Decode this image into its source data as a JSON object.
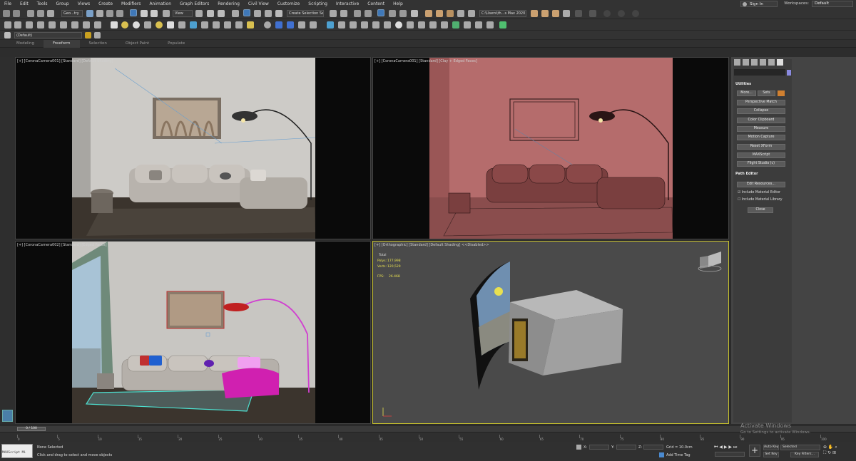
{
  "menu": [
    "File",
    "Edit",
    "Tools",
    "Group",
    "Views",
    "Create",
    "Modifiers",
    "Animation",
    "Graph Editors",
    "Rendering",
    "Civil View",
    "Customize",
    "Scripting",
    "Interactive",
    "Content",
    "Help"
  ],
  "account": {
    "sign_in": "Sign In",
    "workspaces_label": "Workspaces:",
    "workspace": "Default"
  },
  "toolbar": {
    "selection_filter": "Geo...try",
    "view_combo": "View",
    "selection_set": "Create Selection Se",
    "project_path": "C:\\Users\\th...s Max 2020",
    "layer_combo": "(Default)"
  },
  "ribbon": {
    "tabs": [
      "Modeling",
      "Freeform",
      "Selection",
      "Object Paint",
      "Populate"
    ],
    "active": "Freeform"
  },
  "viewports": {
    "top_left": "[+] [CoronaCamera001] [Standard] [Default Shading]",
    "top_right": "[+] [CoronaCamera001] [Standard] [Clay + Edged Faces]",
    "bottom_left": "[+] [CoronaCamera002] [Standard] [Edged Faces]",
    "bottom_right": "[+] [Orthographic] [Standard] [Default Shading]  <<Disabled>>"
  },
  "stats": {
    "total_label": "Total",
    "polys_label": "Polys:",
    "polys": "177,998",
    "verts_label": "Verts:",
    "verts": "120,529",
    "fps_label": "FPS:",
    "fps": "26.468"
  },
  "command_panel": {
    "utilities_title": "Utilities",
    "more": "More...",
    "sets": "Sets",
    "buttons": [
      "Perspective Match",
      "Collapse",
      "Color Clipboard",
      "Measure",
      "Motion Capture",
      "Reset XForm",
      "MAXScript",
      "Flight Studio (c)"
    ],
    "path_editor_title": "Path Editor",
    "edit_resources": "Edit Resources...",
    "include_material_editor": "Include Material Editor",
    "include_material_library": "Include Material Library",
    "close": "Close"
  },
  "timeline": {
    "frame_display": "0 / 100",
    "ticks": [
      "0",
      "5",
      "10",
      "15",
      "20",
      "25",
      "30",
      "35",
      "40",
      "45",
      "50",
      "55",
      "60",
      "65",
      "70",
      "75",
      "80",
      "85",
      "90",
      "95",
      "100"
    ]
  },
  "status": {
    "maxscript": "MAXScript Mi",
    "selection": "None Selected",
    "hint": "Click and drag to select and move objects",
    "x_label": "X:",
    "y_label": "Y:",
    "z_label": "Z:",
    "grid": "Grid = 10.0cm",
    "add_time_tag": "Add Time Tag",
    "auto_key": "Auto Key",
    "set_key": "Set Key",
    "key_selected": "Selected",
    "key_filters": "Key Filters..."
  },
  "watermark": {
    "title": "Activate Windows",
    "subtitle": "Go to Settings to activate Windows."
  },
  "colors": {
    "active_border": "#c6c02d",
    "clay": "#b26a6a",
    "wire_cyan": "#4de0d0",
    "wire_magenta": "#d040d0"
  }
}
